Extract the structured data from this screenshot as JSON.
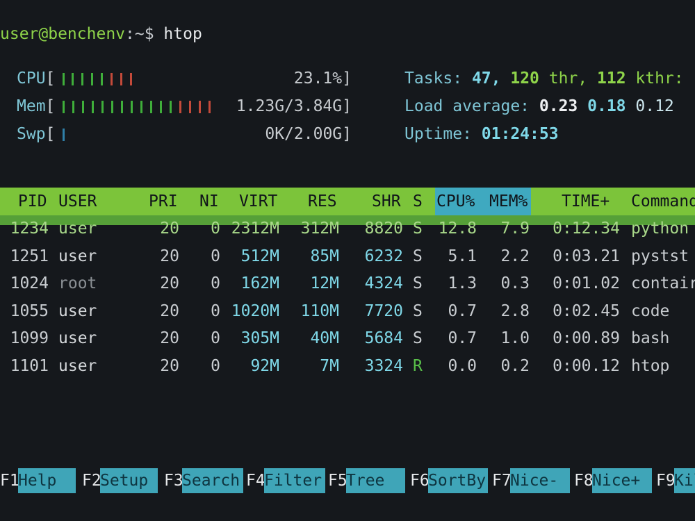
{
  "prompt": {
    "user_host": "user@benchenv",
    "path": ":~$",
    "command": "htop"
  },
  "meters": {
    "cpu": {
      "label": "CPU",
      "value": "23.1%"
    },
    "mem": {
      "label": "Mem",
      "value": "1.23G/3.84G"
    },
    "swp": {
      "label": "Swp",
      "value": "0K/2.00G"
    }
  },
  "stats": {
    "tasks_label": "Tasks:",
    "tasks": "47,",
    "thr": "120",
    "thr_label": "thr,",
    "kthr": "112",
    "kthr_label": "kthr:",
    "load_label": "Load average:",
    "load1": "0.23",
    "load5": "0.18",
    "load15": "0.12",
    "uptime_label": "Uptime:",
    "uptime": "01:24:53"
  },
  "columns": {
    "pid": "PID",
    "user": "USER",
    "pri": "PRI",
    "ni": "NI",
    "virt": "VIRT",
    "res": "RES",
    "shr": "SHR",
    "s": "S",
    "cpu": "CPU%",
    "mem": "MEM%",
    "time": "TIME+",
    "command": "Command"
  },
  "processes": [
    {
      "pid": "1234",
      "user": "user",
      "pri": "20",
      "ni": "0",
      "virt": "2312M",
      "res": "312M",
      "shr": "8820",
      "s": "S",
      "cpu": "12.8",
      "mem": "7.9",
      "time": "0:12.34",
      "command": "python"
    },
    {
      "pid": "1251",
      "user": "user",
      "pri": "20",
      "ni": "0",
      "virt": "512M",
      "res": "85M",
      "shr": "6232",
      "s": "S",
      "cpu": "5.1",
      "mem": "2.2",
      "time": "0:03.21",
      "command": "pystst"
    },
    {
      "pid": "1024",
      "user": "root",
      "pri": "20",
      "ni": "0",
      "virt": "162M",
      "res": "12M",
      "shr": "4324",
      "s": "S",
      "cpu": "1.3",
      "mem": "0.3",
      "time": "0:01.02",
      "command": "contair"
    },
    {
      "pid": "1055",
      "user": "user",
      "pri": "20",
      "ni": "0",
      "virt": "1020M",
      "res": "110M",
      "shr": "7720",
      "s": "S",
      "cpu": "0.7",
      "mem": "2.8",
      "time": "0:02.45",
      "command": "code"
    },
    {
      "pid": "1099",
      "user": "user",
      "pri": "20",
      "ni": "0",
      "virt": "305M",
      "res": "40M",
      "shr": "5684",
      "s": "S",
      "cpu": "0.7",
      "mem": "1.0",
      "time": "0:00.89",
      "command": "bash"
    },
    {
      "pid": "1101",
      "user": "user",
      "pri": "20",
      "ni": "0",
      "virt": "92M",
      "res": "7M",
      "shr": "3324",
      "s": "R",
      "cpu": "0.0",
      "mem": "0.2",
      "time": "0:00.12",
      "command": "htop"
    }
  ],
  "function_keys": [
    {
      "key": "F1",
      "label": "Help"
    },
    {
      "key": "F2",
      "label": "Setup"
    },
    {
      "key": "F3",
      "label": "Search"
    },
    {
      "key": "F4",
      "label": "Filter"
    },
    {
      "key": "F5",
      "label": "Tree"
    },
    {
      "key": "F6",
      "label": "SortBy"
    },
    {
      "key": "F7",
      "label": "Nice-"
    },
    {
      "key": "F8",
      "label": "Nice+"
    },
    {
      "key": "F9",
      "label": "Kill"
    }
  ],
  "colors": {
    "header_bg": "#7cc43a",
    "sort_column_bg": "#3fa9c0",
    "fkey_bg": "#3fa5b8",
    "background": "#15181c"
  }
}
